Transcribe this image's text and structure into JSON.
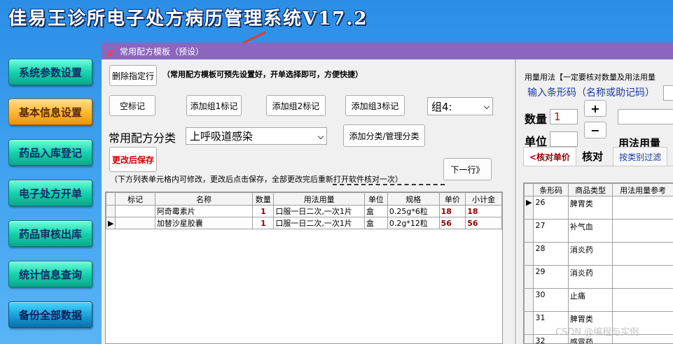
{
  "app": {
    "title": "佳易王诊所电子处方病历管理系统V17.2"
  },
  "sidebar": {
    "items": [
      {
        "label": "系统参数设置"
      },
      {
        "label": "基本信息设置"
      },
      {
        "label": "药品入库登记"
      },
      {
        "label": "电子处方开单"
      },
      {
        "label": "药品审核出库"
      },
      {
        "label": "统计信息查询"
      },
      {
        "label": "备份全部数据"
      }
    ]
  },
  "dialog": {
    "title": "常用配方模板（预设）",
    "delete_row_label": "删除指定行",
    "hint": "（常用配方模板可预先设置好，开单选择即可，方便快捷）",
    "mark_buttons": [
      "空标记",
      "添加组1标记",
      "添加组2标记",
      "添加组3标记"
    ],
    "group_select_value": "组4:",
    "category_label": "常用配方分类",
    "category_value": "上呼吸道感染",
    "manage_category_label": "添加分类/管理分类",
    "save_label": "更改后保存",
    "note": "（下方列表单元格内可修改，更改后点击保存，全部更改完后重新打开软件核对一次）",
    "next_row_label": "下一行》"
  },
  "prescription_table": {
    "columns": [
      "标记",
      "名称",
      "数量",
      "用法用量",
      "单位",
      "规格",
      "单价",
      "小计金"
    ],
    "rows": [
      {
        "mark": "",
        "name": "阿奇霉素片",
        "qty": "1",
        "usage": "口服一日二次,一次1片",
        "unit": "盒",
        "spec": "0.25g*6粒",
        "price": "18",
        "subtotal": "18"
      },
      {
        "mark": "",
        "name": "加替沙星胶囊",
        "qty": "1",
        "usage": "口服一日二次,一次1片",
        "unit": "盒",
        "spec": "0.2g*12粒",
        "price": "56",
        "subtotal": "56"
      }
    ]
  },
  "right_panel": {
    "usage_header": "用量用法【一定要核对数量及用法用量",
    "barcode_label": "输入条形码（名称或助记码）",
    "qty_label": "数量",
    "qty_value": "1",
    "plus_label": "+",
    "minus_label": "−",
    "unit_label": "单位",
    "dosage_label": "用法用量",
    "tabs": [
      "<核对单价",
      "核对",
      "按类别过滤"
    ],
    "drug_table": {
      "columns": [
        "条形码",
        "商品类型",
        "用法用量参考"
      ],
      "rows": [
        {
          "code": "26",
          "type": "脾胃类"
        },
        {
          "code": "27",
          "type": "补气血"
        },
        {
          "code": "28",
          "type": "消炎药"
        },
        {
          "code": "29",
          "type": "消炎药"
        },
        {
          "code": "30",
          "type": "止痛"
        },
        {
          "code": "31",
          "type": "脾胃类"
        },
        {
          "code": "32",
          "type": "感冒药"
        }
      ]
    }
  },
  "watermark": "CSDN @编程与实例",
  "colors": {
    "title_bar": "#8a66bf",
    "menu_green": "#18d3ae",
    "menu_orange": "#ffb730",
    "accent_red": "#d00000",
    "value_dark_red": "#8b0000"
  }
}
